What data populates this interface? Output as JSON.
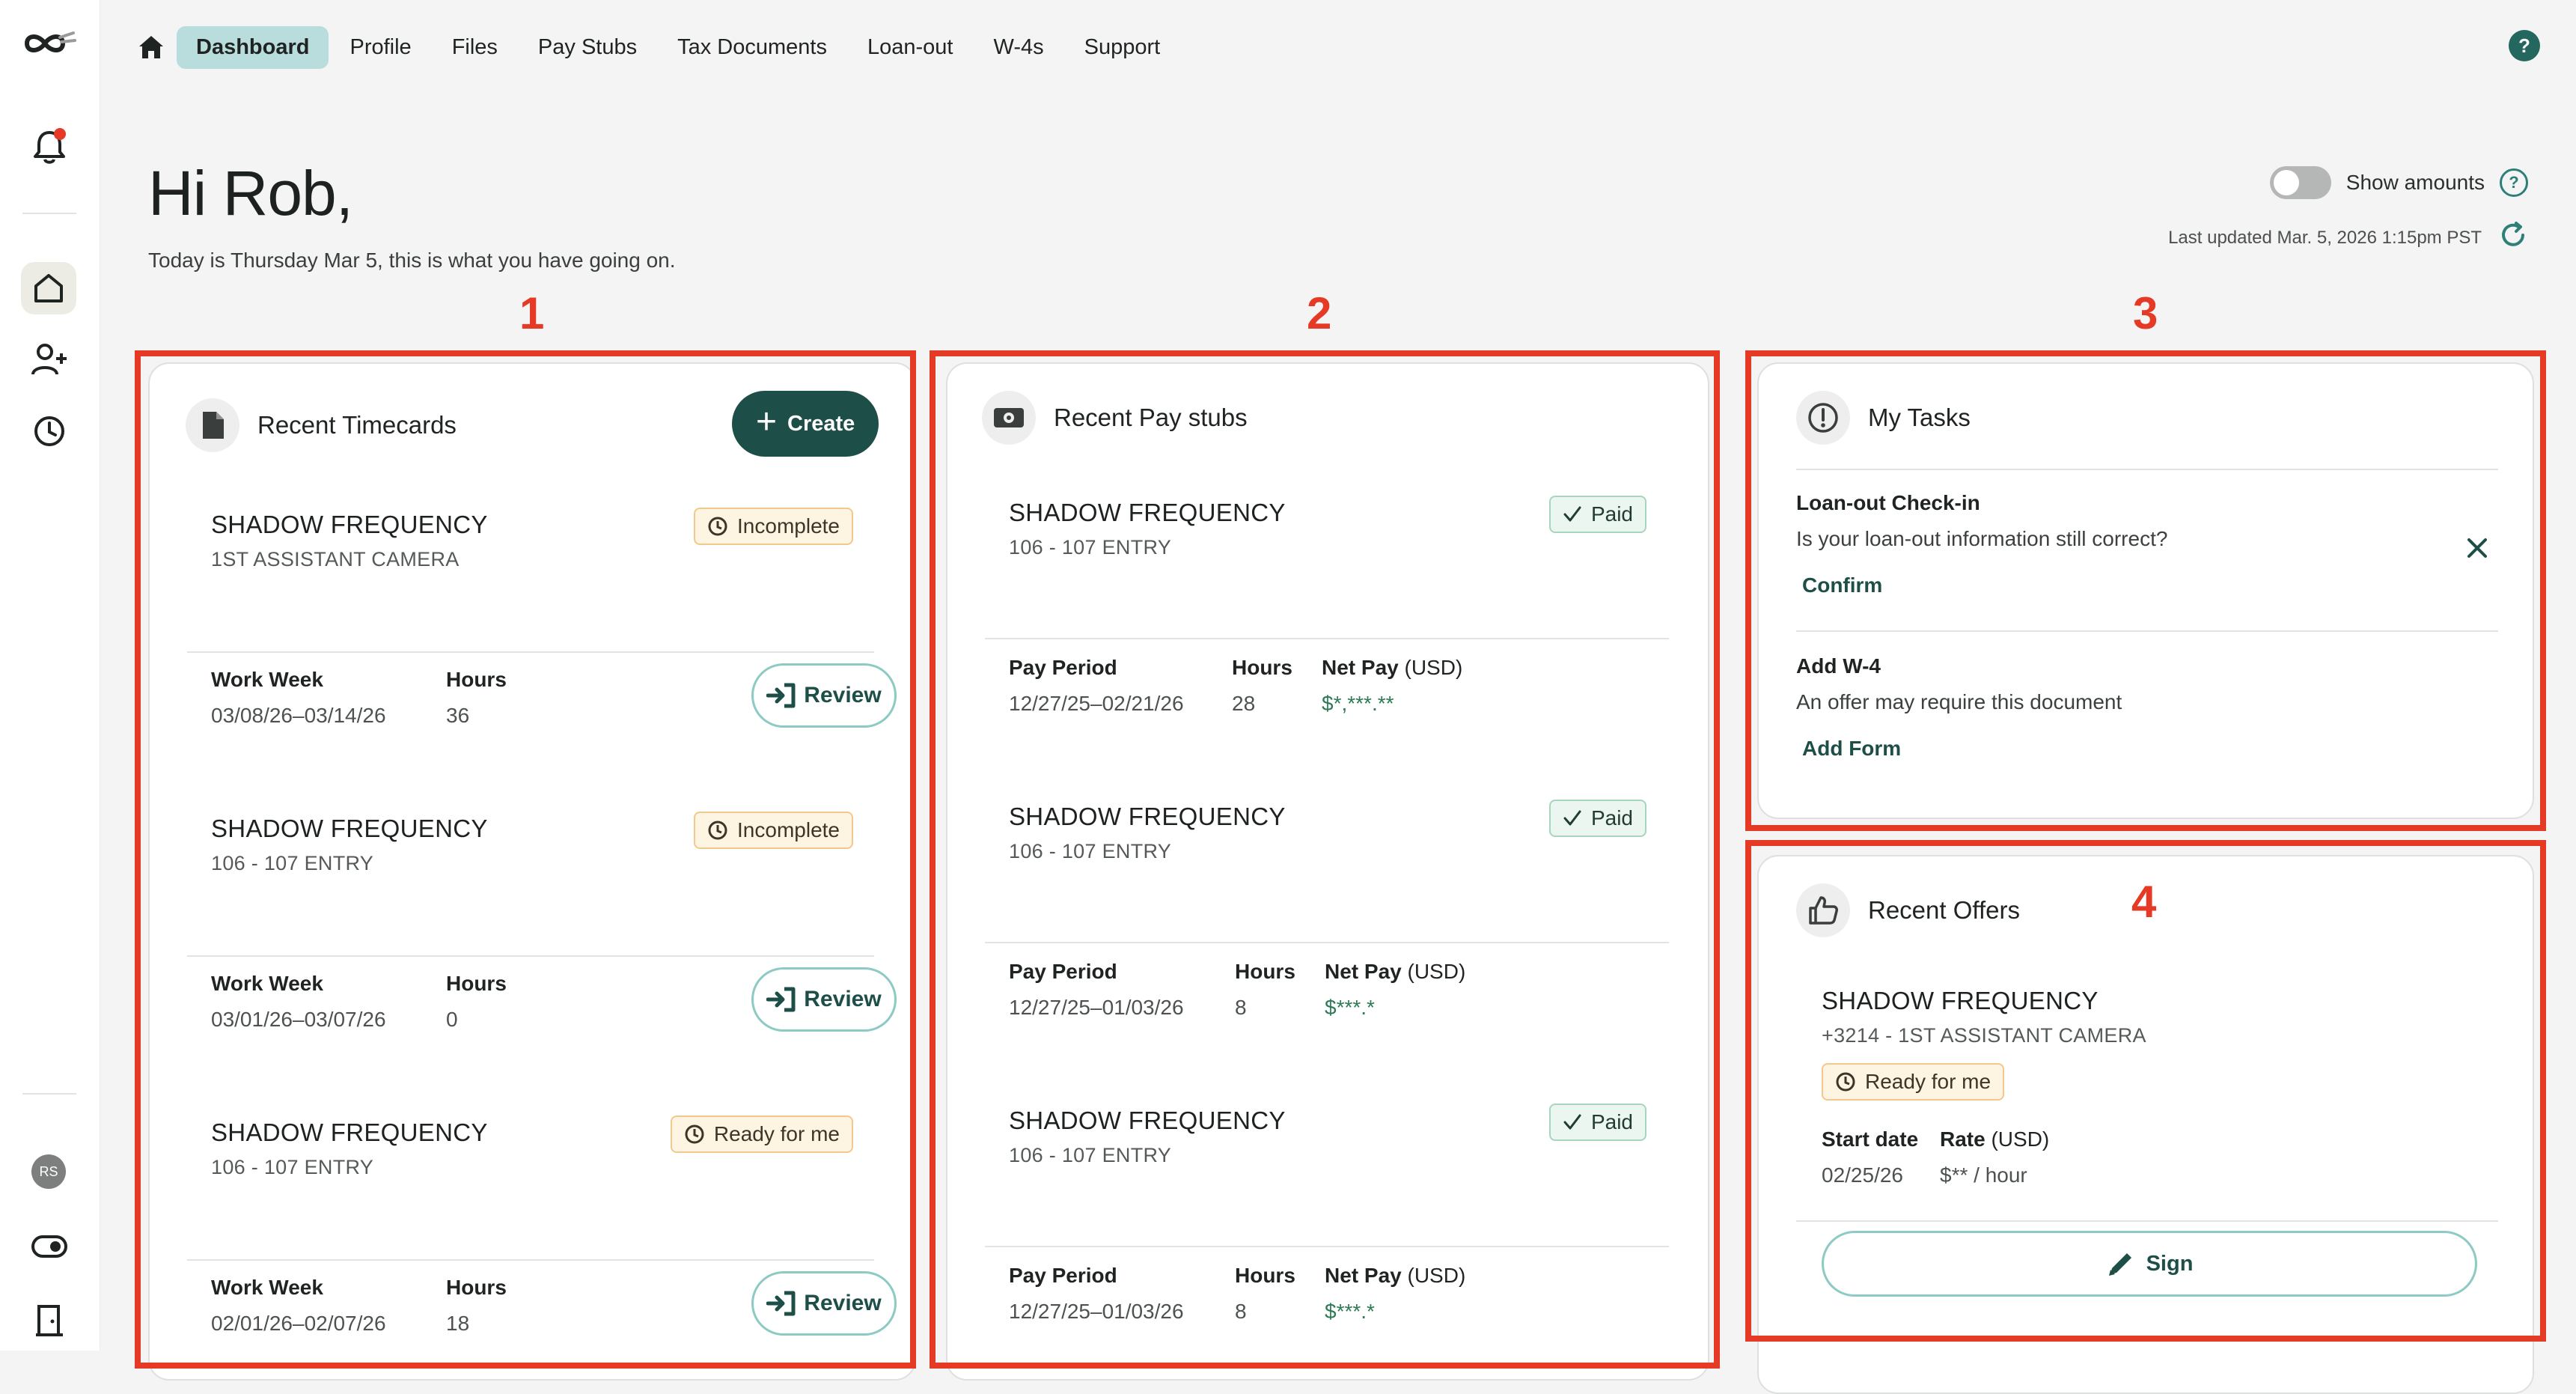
{
  "nav": {
    "tabs": [
      {
        "label": "Dashboard",
        "active": true
      },
      {
        "label": "Profile"
      },
      {
        "label": "Files"
      },
      {
        "label": "Pay Stubs"
      },
      {
        "label": "Tax Documents"
      },
      {
        "label": "Loan-out"
      },
      {
        "label": "W-4s"
      },
      {
        "label": "Support"
      }
    ],
    "help_glyph": "?"
  },
  "sidebar": {
    "icons": [
      "logo-icon",
      "bell-icon",
      "home-icon",
      "add-user-icon",
      "clock-icon",
      "avatar",
      "toggle-icon",
      "exit-door-icon"
    ],
    "avatar_initials": "RS",
    "notification_dot_color": "#e53a26"
  },
  "header": {
    "greeting": "Hi Rob,",
    "subtitle": "Today is Thursday Mar 5, this is what you have going on.",
    "show_amounts_label": "Show amounts",
    "show_amounts_on": false,
    "last_updated": "Last updated Mar. 5, 2026 1:15pm PST"
  },
  "section_numbers": [
    "1",
    "2",
    "3",
    "4"
  ],
  "timecards": {
    "title": "Recent Timecards",
    "create_label": "Create",
    "items": [
      {
        "project": "SHADOW FREQUENCY",
        "role": "1ST ASSISTANT CAMERA",
        "status": "Incomplete",
        "week_label": "Work Week",
        "week": "03/08/26–03/14/26",
        "hours_label": "Hours",
        "hours": "36",
        "action": "Review"
      },
      {
        "project": "SHADOW FREQUENCY",
        "role": "106 - 107 ENTRY",
        "status": "Incomplete",
        "week_label": "Work Week",
        "week": "03/01/26–03/07/26",
        "hours_label": "Hours",
        "hours": "0",
        "action": "Review"
      },
      {
        "project": "SHADOW FREQUENCY",
        "role": "106 - 107 ENTRY",
        "status": "Ready for me",
        "week_label": "Work Week",
        "week": "02/01/26–02/07/26",
        "hours_label": "Hours",
        "hours": "18",
        "action": "Review"
      }
    ]
  },
  "paystubs": {
    "title": "Recent Pay stubs",
    "items": [
      {
        "project": "SHADOW FREQUENCY",
        "role": "106 - 107 ENTRY",
        "status": "Paid",
        "period_label": "Pay Period",
        "period": "12/27/25–02/21/26",
        "hours_label": "Hours",
        "hours": "28",
        "net_label": "Net Pay",
        "net_unit": "(USD)",
        "net": "$*,***.**"
      },
      {
        "project": "SHADOW FREQUENCY",
        "role": "106 - 107 ENTRY",
        "status": "Paid",
        "period_label": "Pay Period",
        "period": "12/27/25–01/03/26",
        "hours_label": "Hours",
        "hours": "8",
        "net_label": "Net Pay",
        "net_unit": "(USD)",
        "net": "$***.*"
      },
      {
        "project": "SHADOW FREQUENCY",
        "role": "106 - 107 ENTRY",
        "status": "Paid",
        "period_label": "Pay Period",
        "period": "12/27/25–01/03/26",
        "hours_label": "Hours",
        "hours": "8",
        "net_label": "Net Pay",
        "net_unit": "(USD)",
        "net": "$***.*"
      }
    ]
  },
  "tasks": {
    "title": "My Tasks",
    "items": [
      {
        "title": "Loan-out Check-in",
        "desc": "Is your loan-out information still correct?",
        "action": "Confirm",
        "dismissable": true
      },
      {
        "title": "Add W-4",
        "desc": "An offer may require this document",
        "action": "Add Form",
        "dismissable": false
      }
    ]
  },
  "offers": {
    "title": "Recent Offers",
    "project": "SHADOW FREQUENCY",
    "role": "+3214 - 1ST ASSISTANT CAMERA",
    "status": "Ready for me",
    "start_label": "Start date",
    "start": "02/25/26",
    "rate_label": "Rate",
    "rate_unit": "(USD)",
    "rate": "$** / hour",
    "action": "Sign"
  },
  "colors": {
    "accent": "#1d4f48",
    "active_tab": "#b9dcdc",
    "annotation_red": "#e53a26",
    "paid_green": "#2d7a55"
  }
}
